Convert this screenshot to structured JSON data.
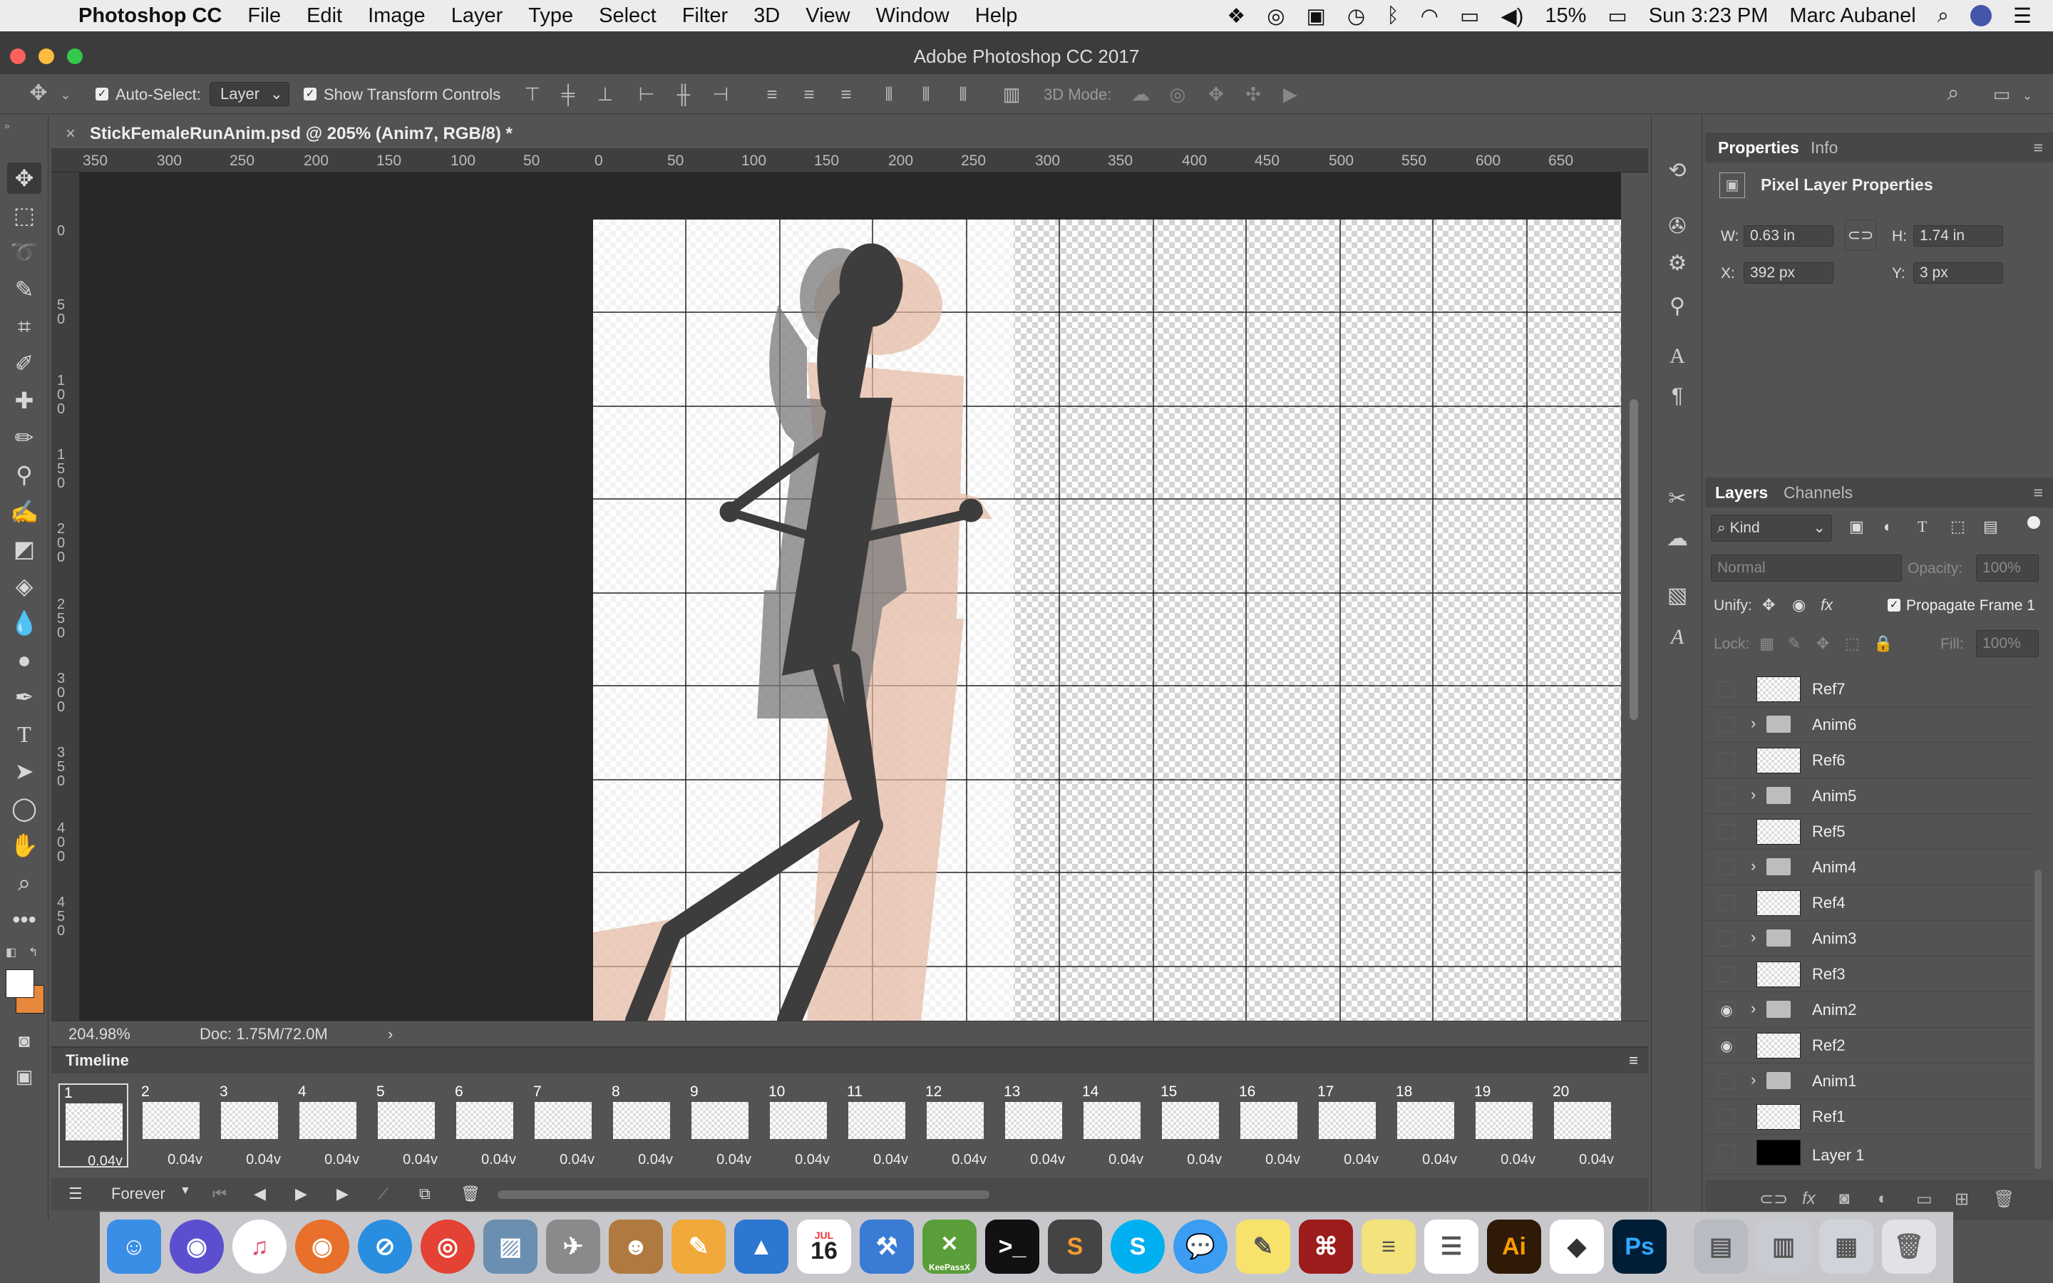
{
  "menubar": {
    "app_name": "Photoshop CC",
    "menus": [
      "File",
      "Edit",
      "Image",
      "Layer",
      "Type",
      "Select",
      "Filter",
      "3D",
      "View",
      "Window",
      "Help"
    ],
    "battery": "15%",
    "clock": "Sun 3:23 PM",
    "user": "Marc Aubanel"
  },
  "window": {
    "title": "Adobe Photoshop CC 2017"
  },
  "options": {
    "auto_select_label": "Auto-Select:",
    "auto_select_value": "Layer",
    "show_transform_label": "Show Transform Controls",
    "mode_3d_label": "3D Mode:"
  },
  "document": {
    "tab_title": "StickFemaleRunAnim.psd @ 205% (Anim7, RGB/8) *",
    "zoom": "204.98%",
    "doc_size": "Doc: 1.75M/72.0M",
    "ruler_labels": [
      "350",
      "300",
      "250",
      "200",
      "150",
      "100",
      "50",
      "0",
      "50",
      "100",
      "150",
      "200",
      "250",
      "300",
      "350",
      "400",
      "450",
      "500",
      "550",
      "600",
      "650"
    ],
    "left_ruler_labels": [
      "0",
      "5 0",
      "1 0 0",
      "1 5 0",
      "2 0 0",
      "2 5 0",
      "3 0 0",
      "3 5 0",
      "4 0 0",
      "4 5 0"
    ]
  },
  "timeline": {
    "title": "Timeline",
    "loop": "Forever",
    "frames": [
      {
        "num": "1",
        "delay": "0.04"
      },
      {
        "num": "2",
        "delay": "0.04"
      },
      {
        "num": "3",
        "delay": "0.04"
      },
      {
        "num": "4",
        "delay": "0.04"
      },
      {
        "num": "5",
        "delay": "0.04"
      },
      {
        "num": "6",
        "delay": "0.04"
      },
      {
        "num": "7",
        "delay": "0.04"
      },
      {
        "num": "8",
        "delay": "0.04"
      },
      {
        "num": "9",
        "delay": "0.04"
      },
      {
        "num": "10",
        "delay": "0.04"
      },
      {
        "num": "11",
        "delay": "0.04"
      },
      {
        "num": "12",
        "delay": "0.04"
      },
      {
        "num": "13",
        "delay": "0.04"
      },
      {
        "num": "14",
        "delay": "0.04"
      },
      {
        "num": "15",
        "delay": "0.04"
      },
      {
        "num": "16",
        "delay": "0.04"
      },
      {
        "num": "17",
        "delay": "0.04"
      },
      {
        "num": "18",
        "delay": "0.04"
      },
      {
        "num": "19",
        "delay": "0.04"
      },
      {
        "num": "20",
        "delay": "0.04"
      }
    ]
  },
  "properties": {
    "tab_properties": "Properties",
    "tab_info": "Info",
    "heading": "Pixel Layer Properties",
    "w_label": "W:",
    "w_value": "0.63 in",
    "h_label": "H:",
    "h_value": "1.74 in",
    "x_label": "X:",
    "x_value": "392 px",
    "y_label": "Y:",
    "y_value": "3 px"
  },
  "layers": {
    "tab_layers": "Layers",
    "tab_channels": "Channels",
    "filter_kind": "Kind",
    "blend_mode": "Normal",
    "opacity_label": "Opacity:",
    "opacity_value": "100%",
    "unify_label": "Unify:",
    "propagate_label": "Propagate Frame 1",
    "lock_label": "Lock:",
    "fill_label": "Fill:",
    "fill_value": "100%",
    "items": [
      {
        "name": "Ref7",
        "type": "layer",
        "visible": false
      },
      {
        "name": "Anim6",
        "type": "group",
        "visible": false
      },
      {
        "name": "Ref6",
        "type": "layer",
        "visible": false
      },
      {
        "name": "Anim5",
        "type": "group",
        "visible": false
      },
      {
        "name": "Ref5",
        "type": "layer",
        "visible": false
      },
      {
        "name": "Anim4",
        "type": "group",
        "visible": false
      },
      {
        "name": "Ref4",
        "type": "layer",
        "visible": false
      },
      {
        "name": "Anim3",
        "type": "group",
        "visible": false
      },
      {
        "name": "Ref3",
        "type": "layer",
        "visible": false
      },
      {
        "name": "Anim2",
        "type": "group",
        "visible": true
      },
      {
        "name": "Ref2",
        "type": "layer",
        "visible": true
      },
      {
        "name": "Anim1",
        "type": "group",
        "visible": false
      },
      {
        "name": "Ref1",
        "type": "layer",
        "visible": false
      },
      {
        "name": "Layer 1",
        "type": "black",
        "visible": false
      }
    ]
  },
  "dock": {
    "calendar_month": "JUL",
    "calendar_day": "16",
    "keepass_label": "KeePassX",
    "ai_label": "Ai",
    "ps_label": "Ps"
  },
  "colors": {
    "accent": "#2c7be5",
    "panel_bg": "#535353",
    "pasteboard": "#282828"
  }
}
